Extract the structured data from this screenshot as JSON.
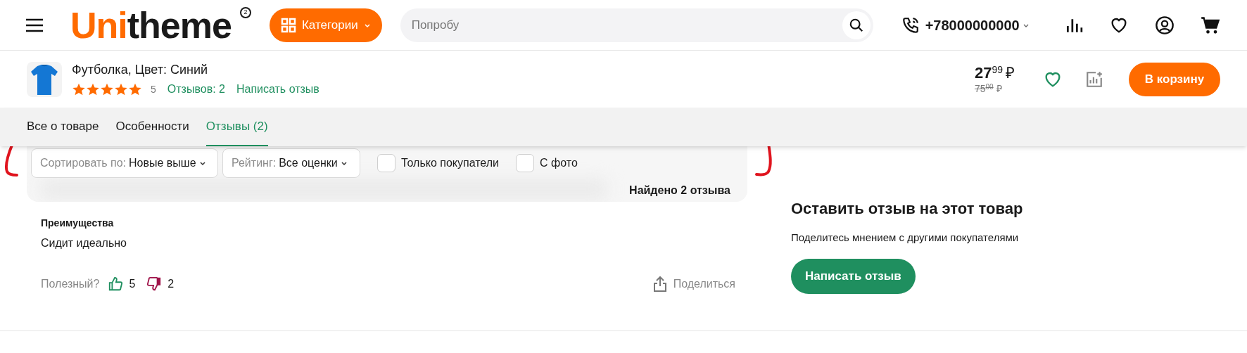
{
  "header": {
    "logo": {
      "accent": "Uni",
      "rest": "theme",
      "badge": "2"
    },
    "categories_button": "Категории",
    "search": {
      "placeholder": "Попробу"
    },
    "phone": "+78000000000"
  },
  "product_bar": {
    "title": "Футболка, Цвет: Синий",
    "stars": 5,
    "rating": "5",
    "reviews_link": "Отзывов: 2",
    "write_link": "Написать отзыв",
    "price_main": "27",
    "price_cents": "99",
    "currency": "₽",
    "old_price_main": "75",
    "old_price_cents": "00",
    "old_currency": "₽",
    "favorite": false,
    "cart_button": "В корзину"
  },
  "tabs": [
    {
      "label": "Все о товаре",
      "selected": false
    },
    {
      "label": "Особенности",
      "selected": false
    },
    {
      "label": "Отзывы (2)",
      "selected": true
    }
  ],
  "filters": {
    "selects": [
      {
        "label": "Сортировать по:",
        "value": "Новые выше"
      },
      {
        "label": "Рейтинг:",
        "value": "Все оценки"
      }
    ],
    "checkboxes": [
      {
        "label": "Только покупатели",
        "checked": false
      },
      {
        "label": "С фото",
        "checked": false
      }
    ],
    "found": "Найдено 2 отзыва"
  },
  "review": {
    "section_title": "Преимущества",
    "text": "Сидит идеально",
    "helpful_label": "Полезный?",
    "likes": "5",
    "dislikes": "2",
    "share": "Поделиться"
  },
  "side": {
    "title": "Оставить отзыв на этот товар",
    "subtitle": "Поделитесь мнением с другими покупателями",
    "button": "Написать отзыв"
  }
}
